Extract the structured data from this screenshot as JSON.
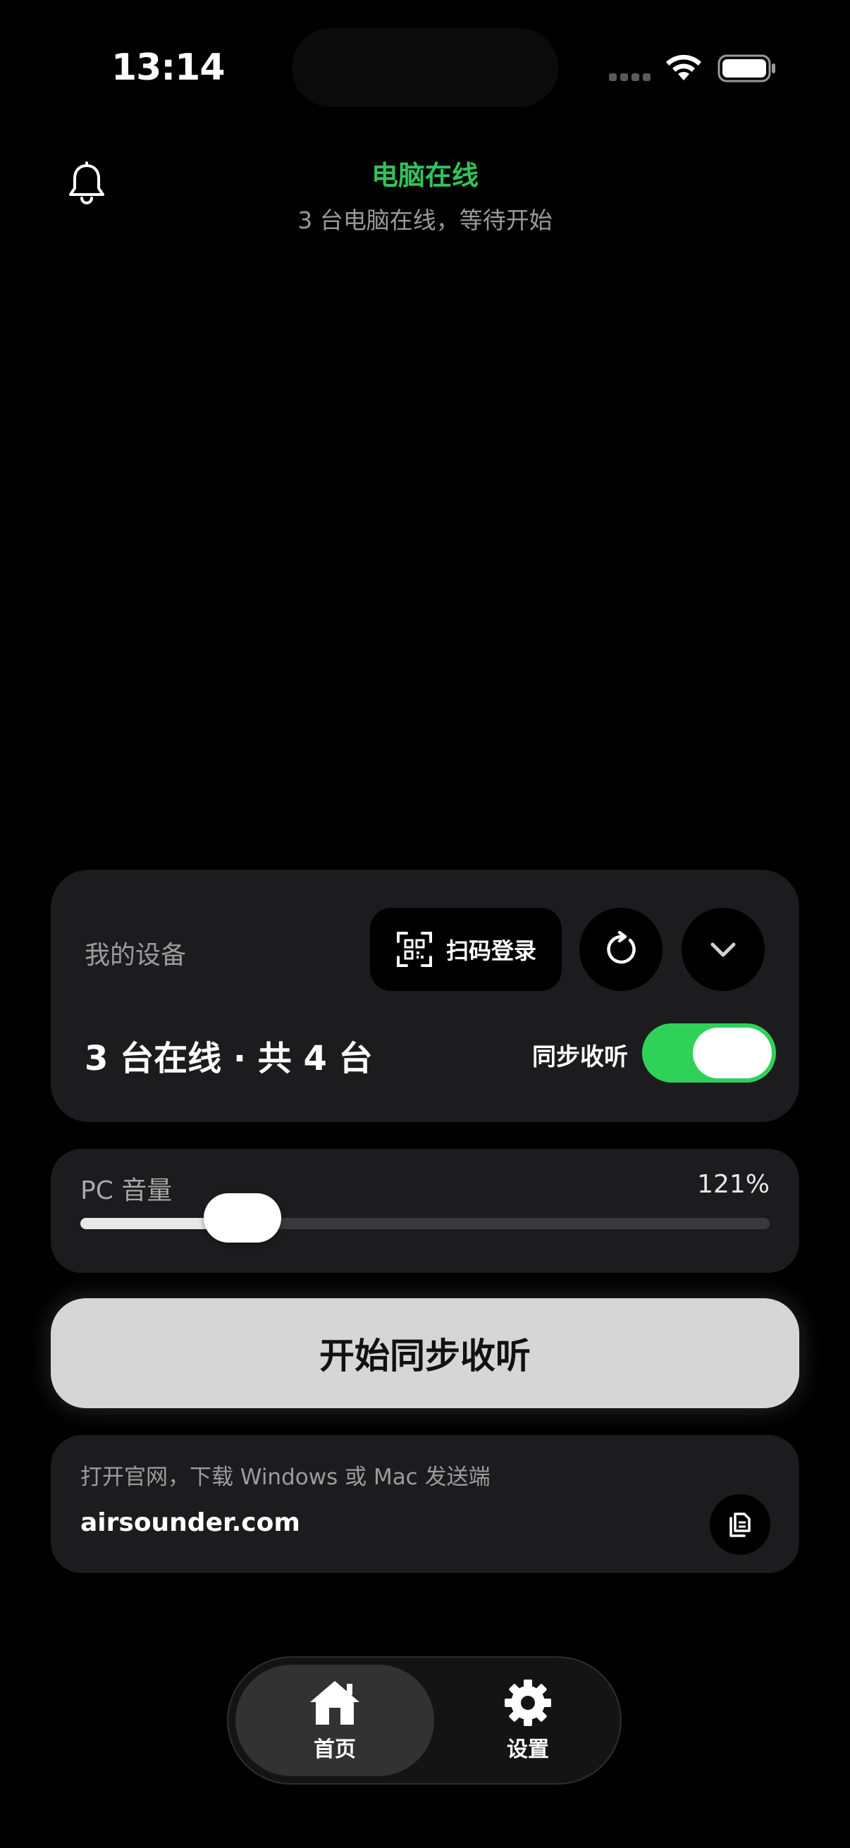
{
  "status_bar": {
    "time": "13:14",
    "icons": [
      "cellular-signal-icon",
      "wifi-icon",
      "battery-icon"
    ]
  },
  "header": {
    "icon": "bell-icon",
    "title": "电脑在线",
    "subtitle": "3 台电脑在线，等待开始",
    "title_color": "#31c35a"
  },
  "devices": {
    "label": "我的设备",
    "scan_button": {
      "icon": "qr-code-icon",
      "label": "扫码登录"
    },
    "refresh_icon": "refresh-icon",
    "expand_icon": "chevron-down-icon",
    "summary": "3 台在线 · 共 4 台",
    "sync_label": "同步收听",
    "sync_enabled": true,
    "toggle_color": "#30d158"
  },
  "volume": {
    "label": "PC 音量",
    "value_text": "121%",
    "slider_fraction": 0.235
  },
  "start_button": {
    "label": "开始同步收听"
  },
  "website": {
    "hint": "打开官网，下载 Windows 或 Mac 发送端",
    "url": "airsounder.com",
    "copy_icon": "copy-icon"
  },
  "tab_bar": {
    "tabs": [
      {
        "label": "首页",
        "icon": "home-icon",
        "selected": true
      },
      {
        "label": "设置",
        "icon": "gear-icon",
        "selected": false
      }
    ]
  }
}
